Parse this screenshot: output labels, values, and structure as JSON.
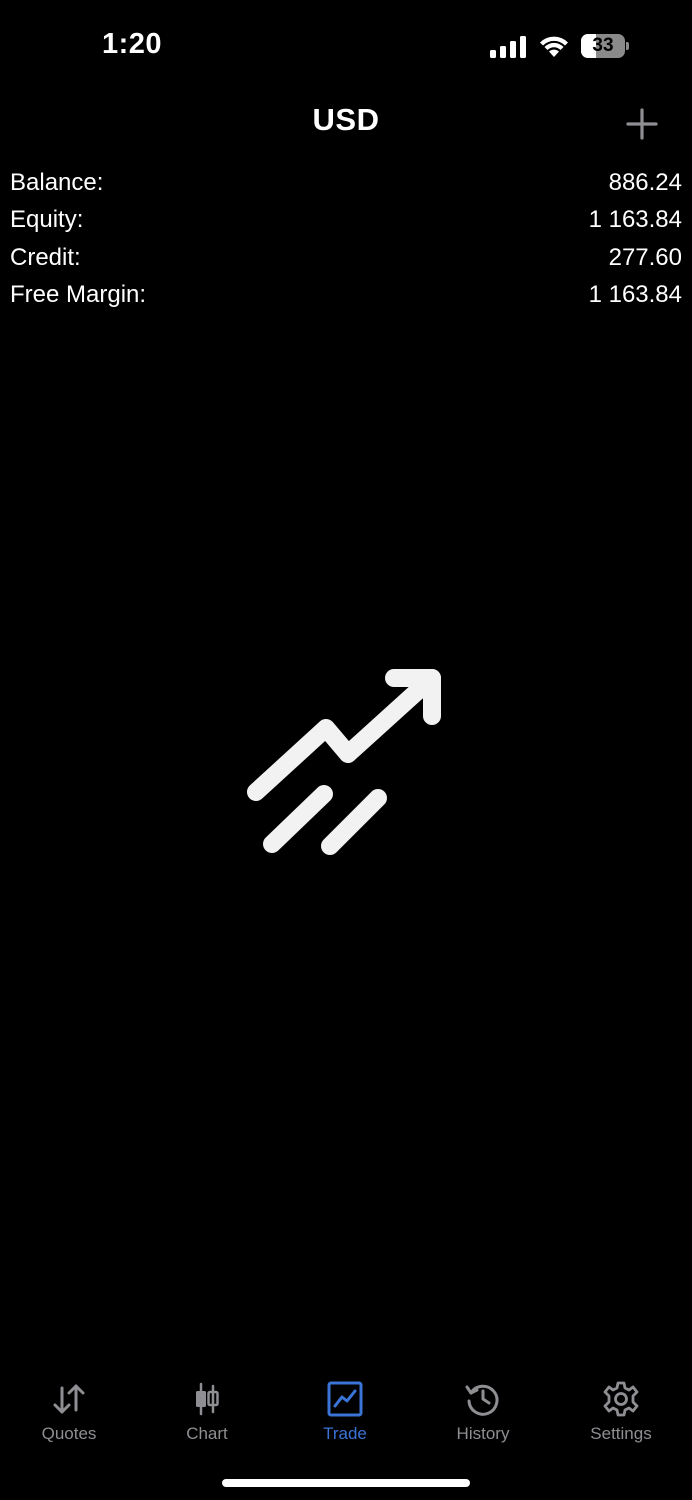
{
  "status_bar": {
    "time": "1:20",
    "battery_level": "33",
    "battery_fraction": 0.33
  },
  "header": {
    "title": "USD",
    "add_icon": "plus-icon"
  },
  "summary": [
    {
      "label": "Balance:",
      "value": "886.24"
    },
    {
      "label": "Equity:",
      "value": "1 163.84"
    },
    {
      "label": "Credit:",
      "value": "277.60"
    },
    {
      "label": "Free Margin:",
      "value": "1 163.84"
    }
  ],
  "empty_state": {
    "icon": "trending-up-icon"
  },
  "tabs": [
    {
      "label": "Quotes",
      "icon": "quotes-arrows-icon",
      "active": false
    },
    {
      "label": "Chart",
      "icon": "candlestick-icon",
      "active": false
    },
    {
      "label": "Trade",
      "icon": "trade-chart-icon",
      "active": true
    },
    {
      "label": "History",
      "icon": "history-clock-icon",
      "active": false
    },
    {
      "label": "Settings",
      "icon": "gear-icon",
      "active": false
    }
  ],
  "colors": {
    "background": "#000000",
    "text": "#ffffff",
    "tab_inactive": "#8e8e93",
    "tab_active": "#3a74d6"
  }
}
